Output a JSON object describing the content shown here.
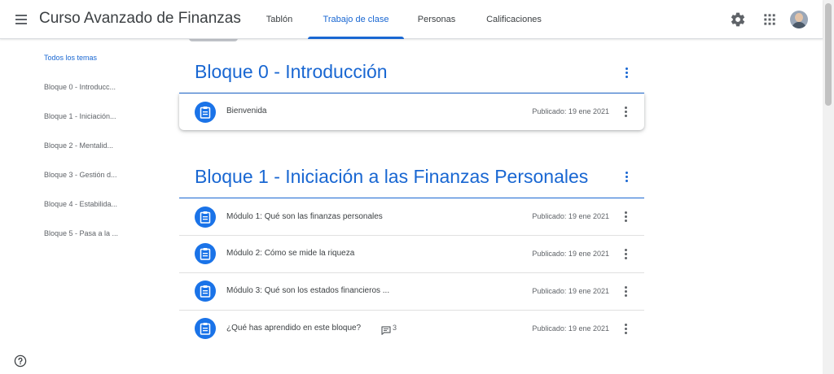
{
  "header": {
    "course_title": "Curso Avanzado de Finanzas Pe...",
    "tabs": [
      {
        "label": "Tablón",
        "active": false
      },
      {
        "label": "Trabajo de clase",
        "active": true
      },
      {
        "label": "Personas",
        "active": false
      },
      {
        "label": "Calificaciones",
        "active": false
      }
    ],
    "icons": [
      "menu-icon",
      "settings-icon",
      "apps-grid-icon",
      "user-avatar"
    ]
  },
  "sidebar": {
    "items": [
      {
        "label": "Todos los temas",
        "active": true
      },
      {
        "label": "Bloque 0 - Introducc..."
      },
      {
        "label": "Bloque 1 - Iniciación..."
      },
      {
        "label": "Bloque 2 - Mentalid..."
      },
      {
        "label": "Bloque 3 - Gestión d..."
      },
      {
        "label": "Bloque 4 - Estabilida..."
      },
      {
        "label": "Bloque 5 - Pasa a la ..."
      }
    ]
  },
  "sections": [
    {
      "title": "Bloque 0 - Introducción",
      "items": [
        {
          "title": "Bienvenida",
          "date": "Publicado: 19 ene 2021",
          "icon": "assignment-icon"
        }
      ]
    },
    {
      "title": "Bloque 1 - Iniciación a las Finanzas Personales",
      "items": [
        {
          "title": "Módulo 1: Qué son las finanzas personales",
          "date": "Publicado: 19 ene 2021",
          "icon": "assignment-icon"
        },
        {
          "title": "Módulo 2: Cómo se mide la riqueza",
          "date": "Publicado: 19 ene 2021",
          "icon": "assignment-icon"
        },
        {
          "title": "Módulo 3: Qué son los estados financieros ...",
          "date": "Publicado: 19 ene 2021",
          "icon": "assignment-icon"
        },
        {
          "title": "¿Qué has aprendido en este bloque?",
          "comments": "3",
          "date": "Publicado: 19 ene 2021",
          "icon": "assignment-icon"
        }
      ]
    }
  ],
  "colors": {
    "accent": "#1967d2",
    "icon_bg": "#1a73e8",
    "text": "#3c4043",
    "muted": "#5f6368"
  }
}
